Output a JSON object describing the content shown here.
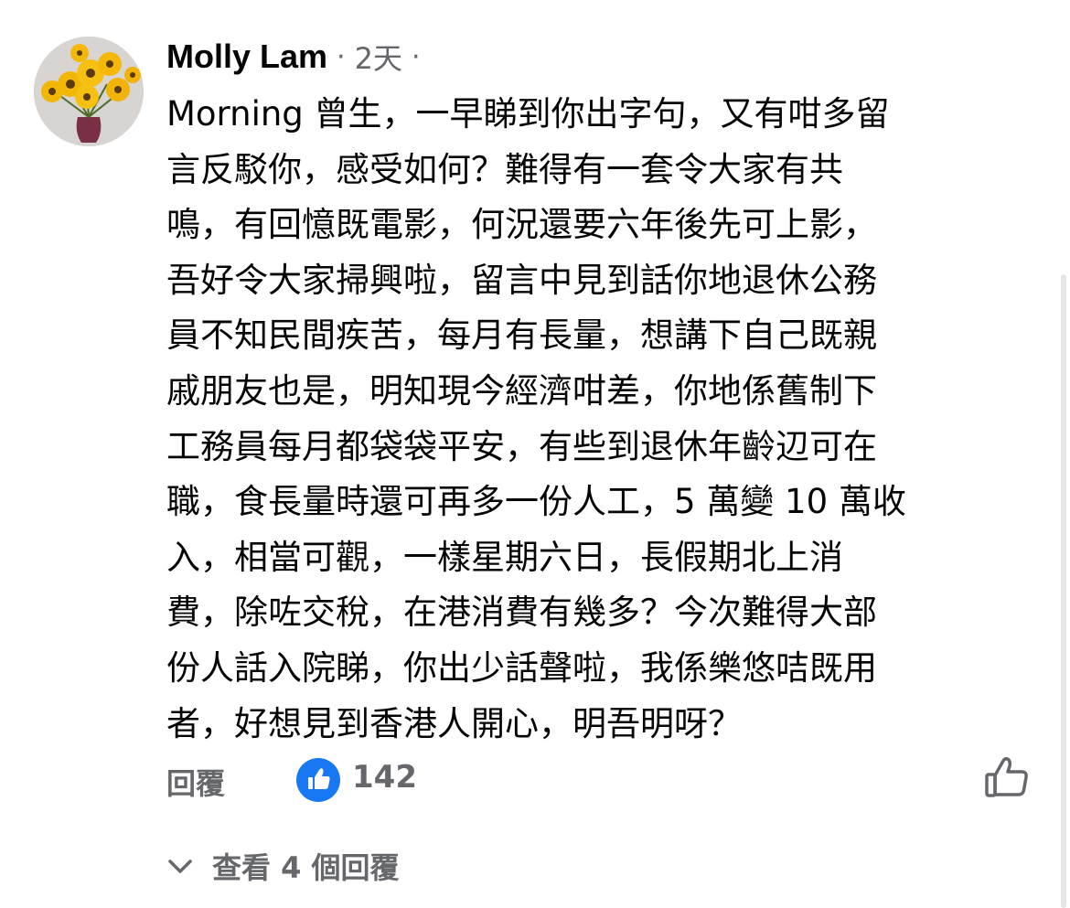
{
  "comment": {
    "author": "Molly Lam",
    "separator": "·",
    "time": "2天",
    "trailing_dot": "·",
    "lines": [
      "Morning 曾生，一早睇到你出字句，又有咁多留",
      "言反駁你，感受如何？難得有一套令大家有共",
      "鳴，有回憶既電影，何況還要六年後先可上影，",
      "吾好令大家掃興啦，留言中見到話你地退休公務",
      "員不知民間疾苦，每月有長量，想講下自己既親",
      "戚朋友也是，明知現今經濟咁差，你地係舊制下",
      "工務員每月都袋袋平安，有些到退休年齡辺可在",
      "職，食長量時還可再多一份人工，5 萬變 10 萬收",
      "入，相當可觀，一樣星期六日，長假期北上消",
      "費，除咗交稅，在港消費有幾多？今次難得大部",
      "份人話入院睇，你出少話聲啦，我係樂悠咭既用",
      "者，好想見到香港人開心，明吾明呀？"
    ]
  },
  "actions": {
    "reply_label": "回覆",
    "like_count": "142"
  },
  "view_replies_label": "查看 4 個回覆",
  "colors": {
    "text": "#050505",
    "secondary": "#65676b",
    "like_blue": "#1877f2"
  },
  "icons": {
    "avatar": "sunflower-avatar",
    "like_badge": "thumbs-up-icon",
    "like_button": "thumbs-up-outline-icon",
    "expand": "chevron-down-icon"
  }
}
